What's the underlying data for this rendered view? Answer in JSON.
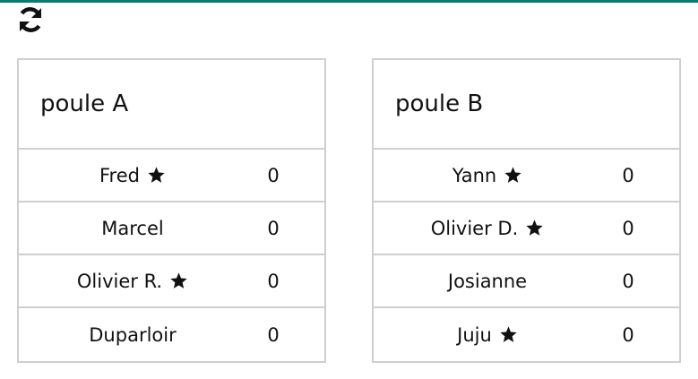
{
  "poules": [
    {
      "title": "poule A",
      "players": [
        {
          "name": "Fred",
          "starred": true,
          "score": "0"
        },
        {
          "name": "Marcel",
          "starred": false,
          "score": "0"
        },
        {
          "name": "Olivier R.",
          "starred": true,
          "score": "0"
        },
        {
          "name": "Duparloir",
          "starred": false,
          "score": "0"
        }
      ]
    },
    {
      "title": "poule B",
      "players": [
        {
          "name": "Yann",
          "starred": true,
          "score": "0"
        },
        {
          "name": "Olivier D.",
          "starred": true,
          "score": "0"
        },
        {
          "name": "Josianne",
          "starred": false,
          "score": "0"
        },
        {
          "name": "Juju",
          "starred": true,
          "score": "0"
        }
      ]
    }
  ],
  "icons": {
    "refresh": "refresh-icon",
    "star": "star-icon"
  },
  "colors": {
    "accent": "#0b7a72",
    "border": "#cfcfcf",
    "text": "#111111"
  }
}
